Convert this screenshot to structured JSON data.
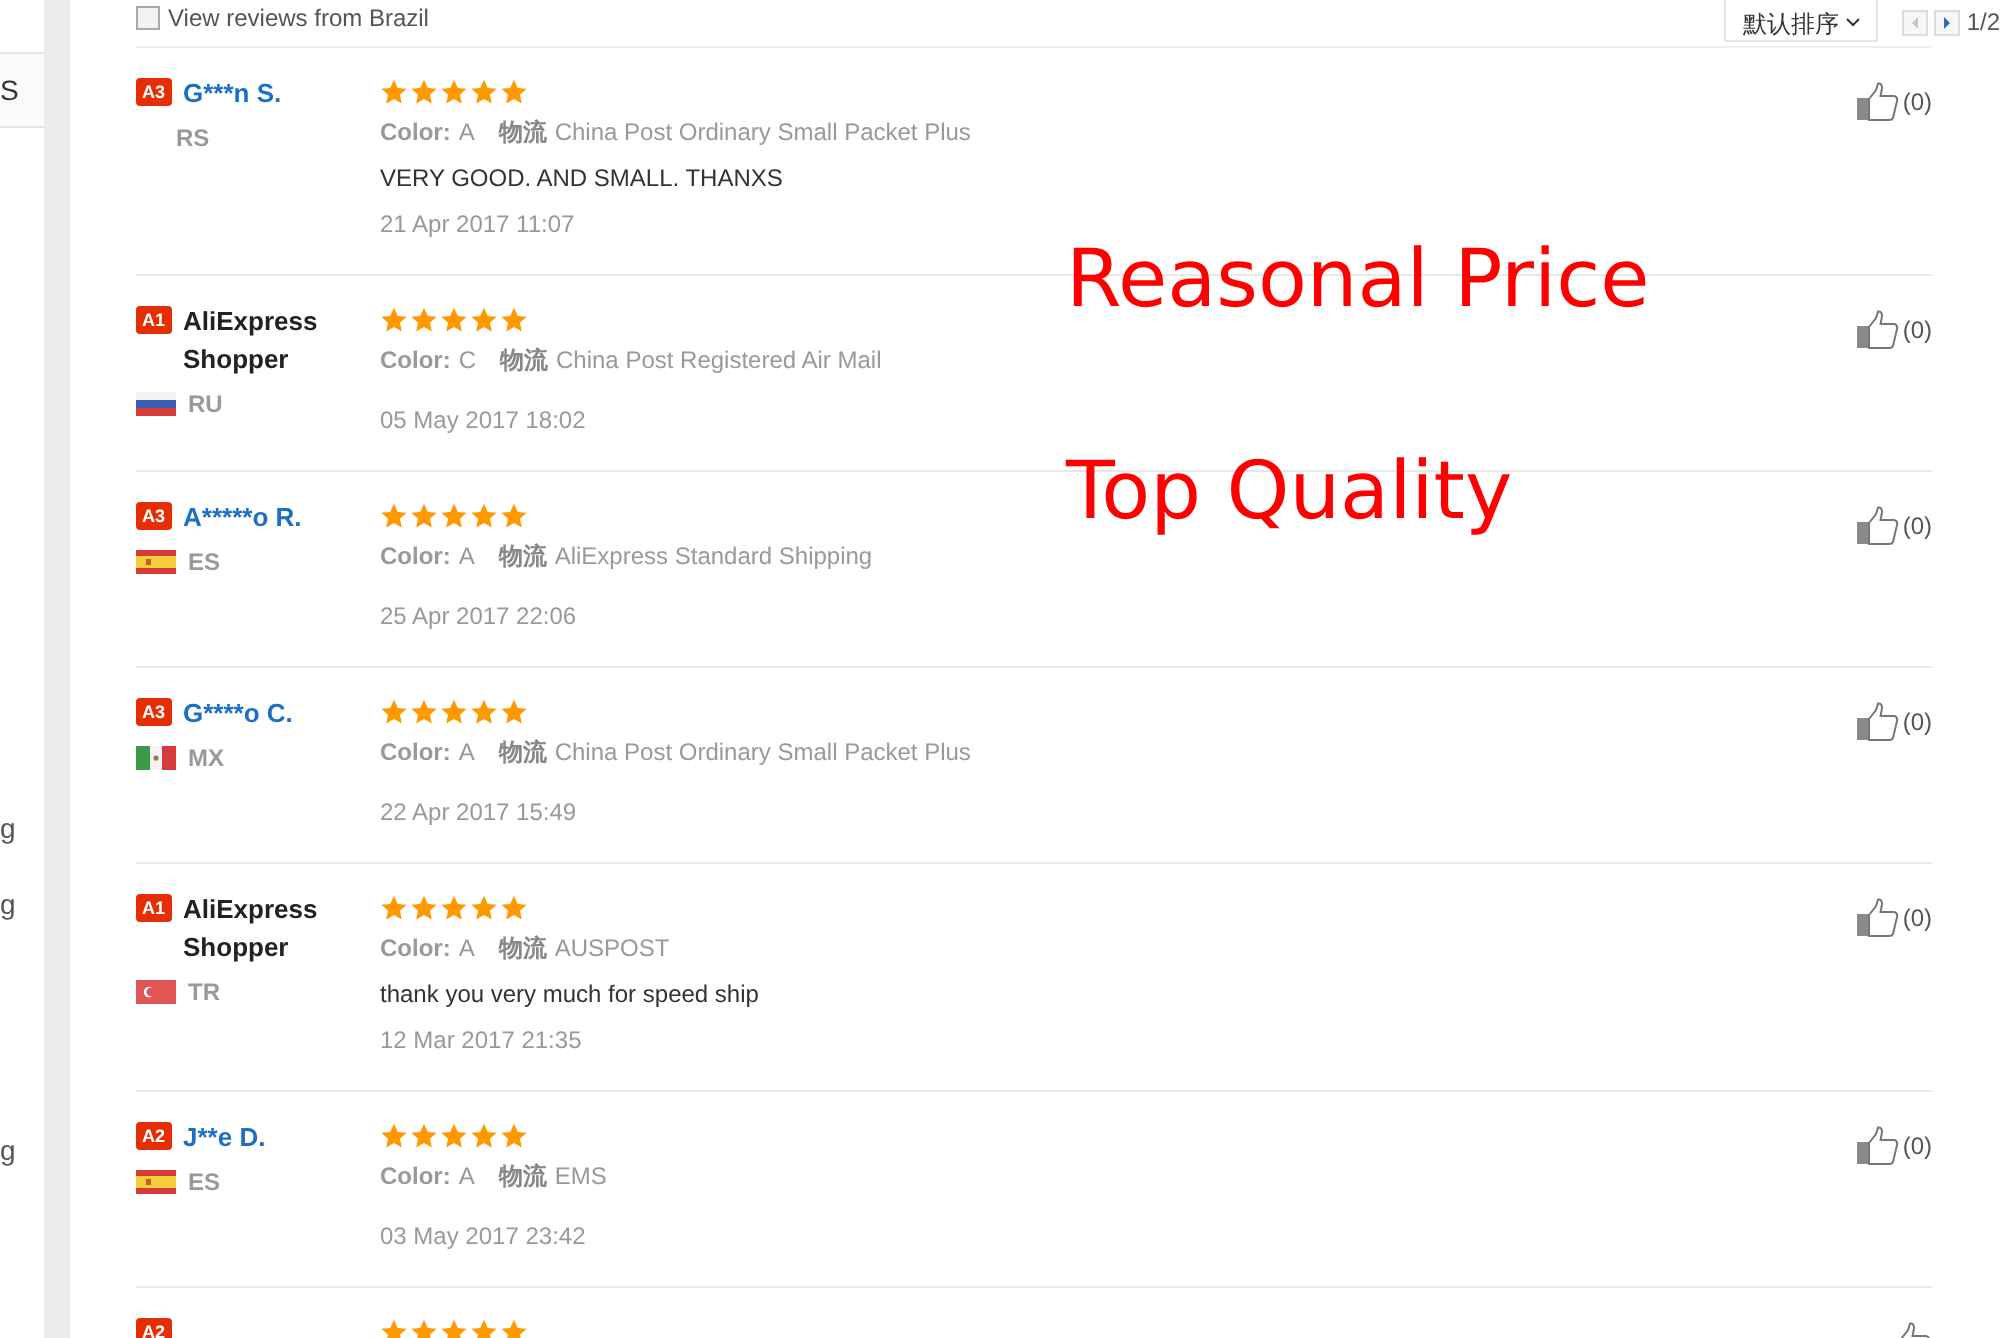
{
  "sidebar": {
    "items": [
      {
        "label": "S",
        "selected": true
      },
      {
        "label": "g",
        "selected": false
      },
      {
        "label": "g",
        "selected": false
      },
      {
        "label": "g",
        "selected": false
      }
    ]
  },
  "filter": {
    "label": "View reviews from Brazil",
    "checked": false
  },
  "sort": {
    "label": "默认排序"
  },
  "pager": {
    "prev_disabled": true,
    "next_disabled": false,
    "page": "1/2"
  },
  "reviews": [
    {
      "badge": "A3",
      "name": "G***n S.",
      "kind": "buyer",
      "country": "RS",
      "stars": 5,
      "color_label": "Color:",
      "color_value": "A",
      "shipping_label": "物流",
      "shipping": "China Post Ordinary Small Packet Plus",
      "comment": "VERY GOOD. AND SMALL. THANXS",
      "date": "21 Apr 2017 11:07",
      "likes": "(0)"
    },
    {
      "badge": "A1",
      "name": "AliExpress Shopper",
      "kind": "shopper",
      "flag": {
        "kind": "ru"
      },
      "country": "RU",
      "stars": 5,
      "color_label": "Color:",
      "color_value": "C",
      "shipping_label": "物流",
      "shipping": "China Post Registered Air Mail",
      "date": "05 May 2017 18:02",
      "likes": "(0)"
    },
    {
      "badge": "A3",
      "name": "A*****o R.",
      "kind": "buyer",
      "flag": {
        "kind": "es"
      },
      "country": "ES",
      "stars": 5,
      "color_label": "Color:",
      "color_value": "A",
      "shipping_label": "物流",
      "shipping": "AliExpress Standard Shipping",
      "date": "25 Apr 2017 22:06",
      "likes": "(0)"
    },
    {
      "badge": "A3",
      "name": "G****o C.",
      "kind": "buyer",
      "flag": {
        "kind": "mx"
      },
      "country": "MX",
      "stars": 5,
      "color_label": "Color:",
      "color_value": "A",
      "shipping_label": "物流",
      "shipping": "China Post Ordinary Small Packet Plus",
      "date": "22 Apr 2017 15:49",
      "likes": "(0)"
    },
    {
      "badge": "A1",
      "name": "AliExpress Shopper",
      "kind": "shopper",
      "flag": {
        "kind": "tr"
      },
      "country": "TR",
      "stars": 5,
      "color_label": "Color:",
      "color_value": "A",
      "shipping_label": "物流",
      "shipping": "AUSPOST",
      "comment": "thank you very much for speed ship",
      "date": "12 Mar 2017 21:35",
      "likes": "(0)"
    },
    {
      "badge": "A2",
      "name": "J**e D.",
      "kind": "buyer",
      "flag": {
        "kind": "es"
      },
      "country": "ES",
      "stars": 5,
      "color_label": "Color:",
      "color_value": "A",
      "shipping_label": "物流",
      "shipping": "EMS",
      "date": "03 May 2017 23:42",
      "likes": "(0)"
    },
    {
      "badge": "A2",
      "stars": 5
    }
  ],
  "overlay": [
    {
      "text": "Reasonal Price"
    },
    {
      "text": "Top Quality"
    }
  ]
}
